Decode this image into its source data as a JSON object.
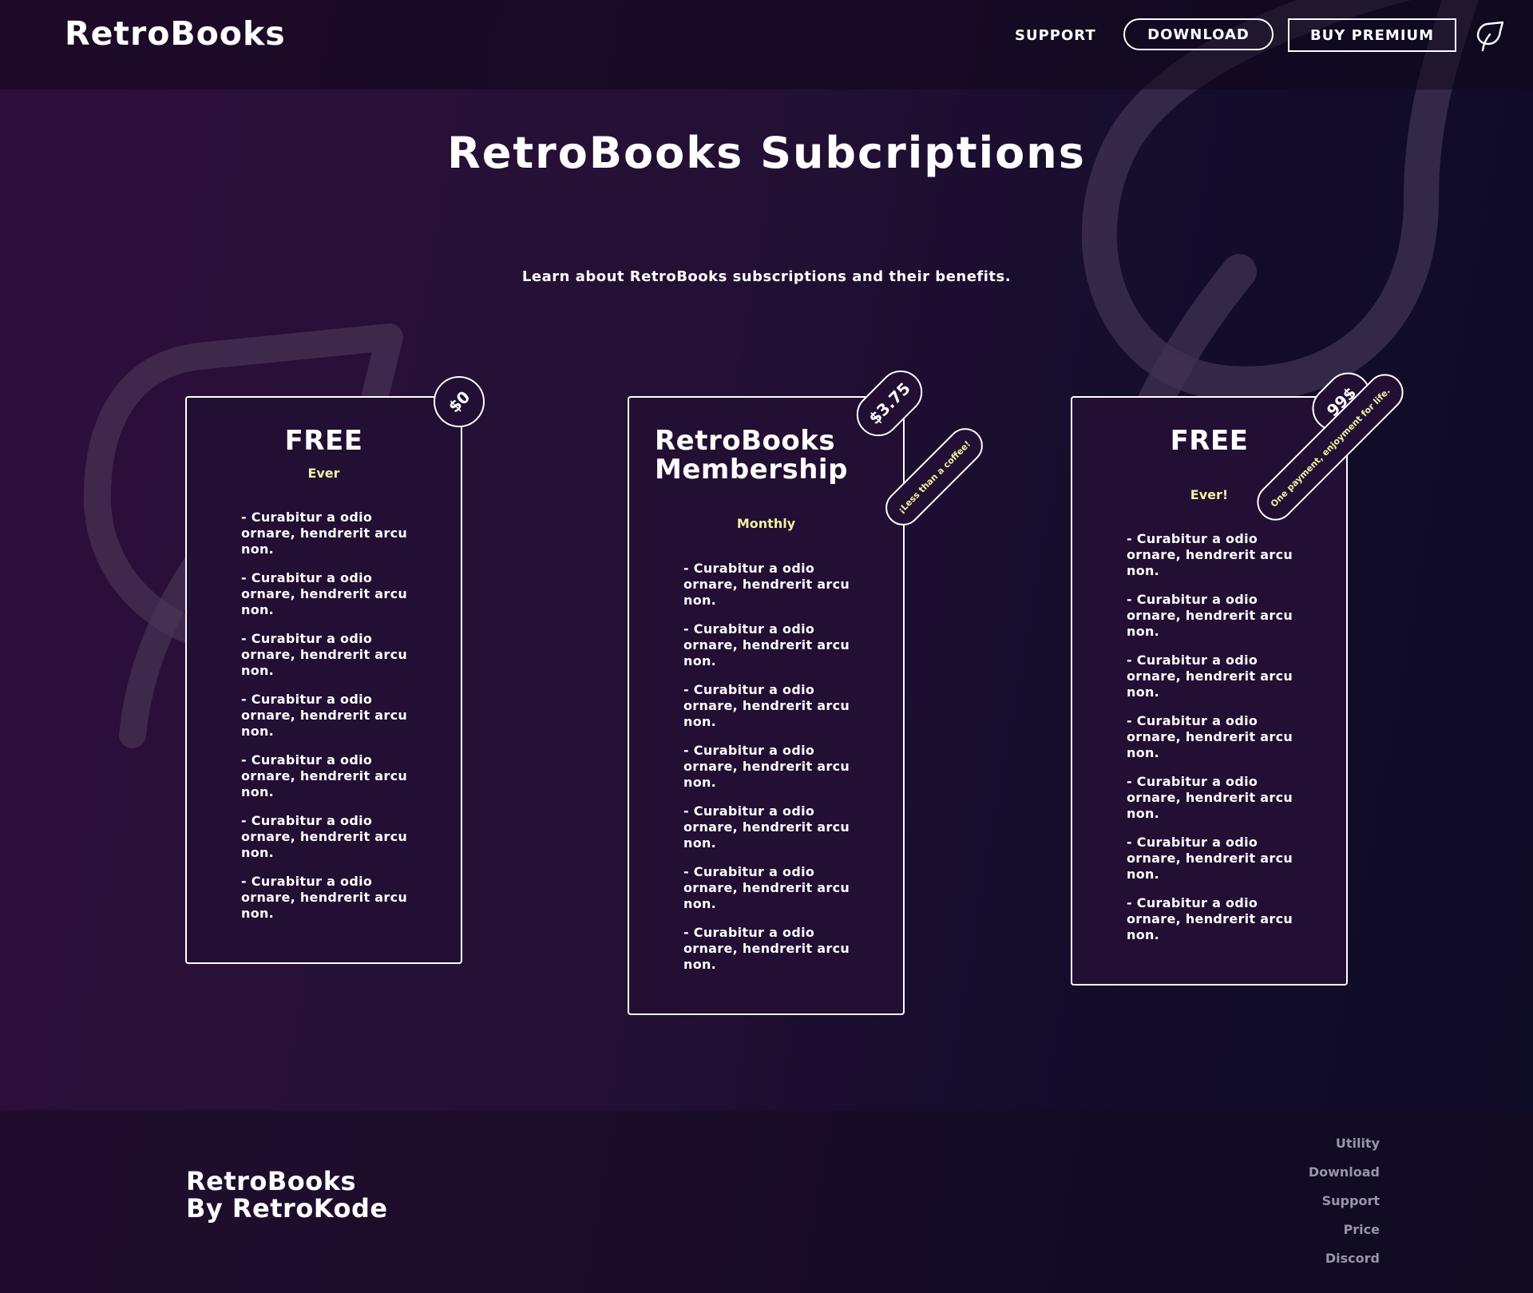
{
  "header": {
    "logo": "RetroBooks",
    "nav": {
      "support": "SUPPORT",
      "download": "DOWNLOAD",
      "buy_premium": "BUY PREMIUM"
    }
  },
  "hero": {
    "title": "RetroBooks Subcriptions",
    "subtitle": "Learn about RetroBooks subscriptions and their benefits."
  },
  "plans": [
    {
      "title": "FREE",
      "period": "Ever",
      "price": "$0",
      "note": "",
      "features": [
        "- Curabitur a odio ornare, hendrerit arcu non.",
        "- Curabitur a odio ornare, hendrerit arcu non.",
        "- Curabitur a odio ornare, hendrerit arcu non.",
        "- Curabitur a odio ornare, hendrerit arcu non.",
        "- Curabitur a odio ornare, hendrerit arcu non.",
        "- Curabitur a odio ornare, hendrerit arcu non.",
        "- Curabitur a odio ornare, hendrerit arcu non."
      ]
    },
    {
      "title_line1": "RetroBooks",
      "title_line2": "Membership",
      "period": "Monthly",
      "price": "$3.75",
      "note": "¡Less than a coffee!",
      "features": [
        "- Curabitur a odio ornare, hendrerit arcu non.",
        "- Curabitur a odio ornare, hendrerit arcu non.",
        "- Curabitur a odio ornare, hendrerit arcu non.",
        "- Curabitur a odio ornare, hendrerit arcu non.",
        "- Curabitur a odio ornare, hendrerit arcu non.",
        "- Curabitur a odio ornare, hendrerit arcu non.",
        "- Curabitur a odio ornare, hendrerit arcu non."
      ]
    },
    {
      "title": "FREE",
      "period": "Ever!",
      "price": "99$",
      "note": "One payment, enjoyment for life.",
      "features": [
        "- Curabitur a odio ornare, hendrerit arcu non.",
        "- Curabitur a odio ornare, hendrerit arcu non.",
        "- Curabitur a odio ornare, hendrerit arcu non.",
        "- Curabitur a odio ornare, hendrerit arcu non.",
        "- Curabitur a odio ornare, hendrerit arcu non.",
        "- Curabitur a odio ornare, hendrerit arcu non.",
        "- Curabitur a odio ornare, hendrerit arcu non."
      ]
    }
  ],
  "footer": {
    "brand_line1": "RetroBooks",
    "brand_line2": "By RetroKode",
    "links": [
      "Utility",
      "Download",
      "Support",
      "Price",
      "Discord"
    ]
  },
  "icons": {
    "nav_icon": "leaf-icon",
    "background": "leaf-outline-icon"
  },
  "colors": {
    "accent_yellow": "#f4f0a2",
    "card_bg": "#220f33",
    "footer_link": "#9a94a8"
  }
}
